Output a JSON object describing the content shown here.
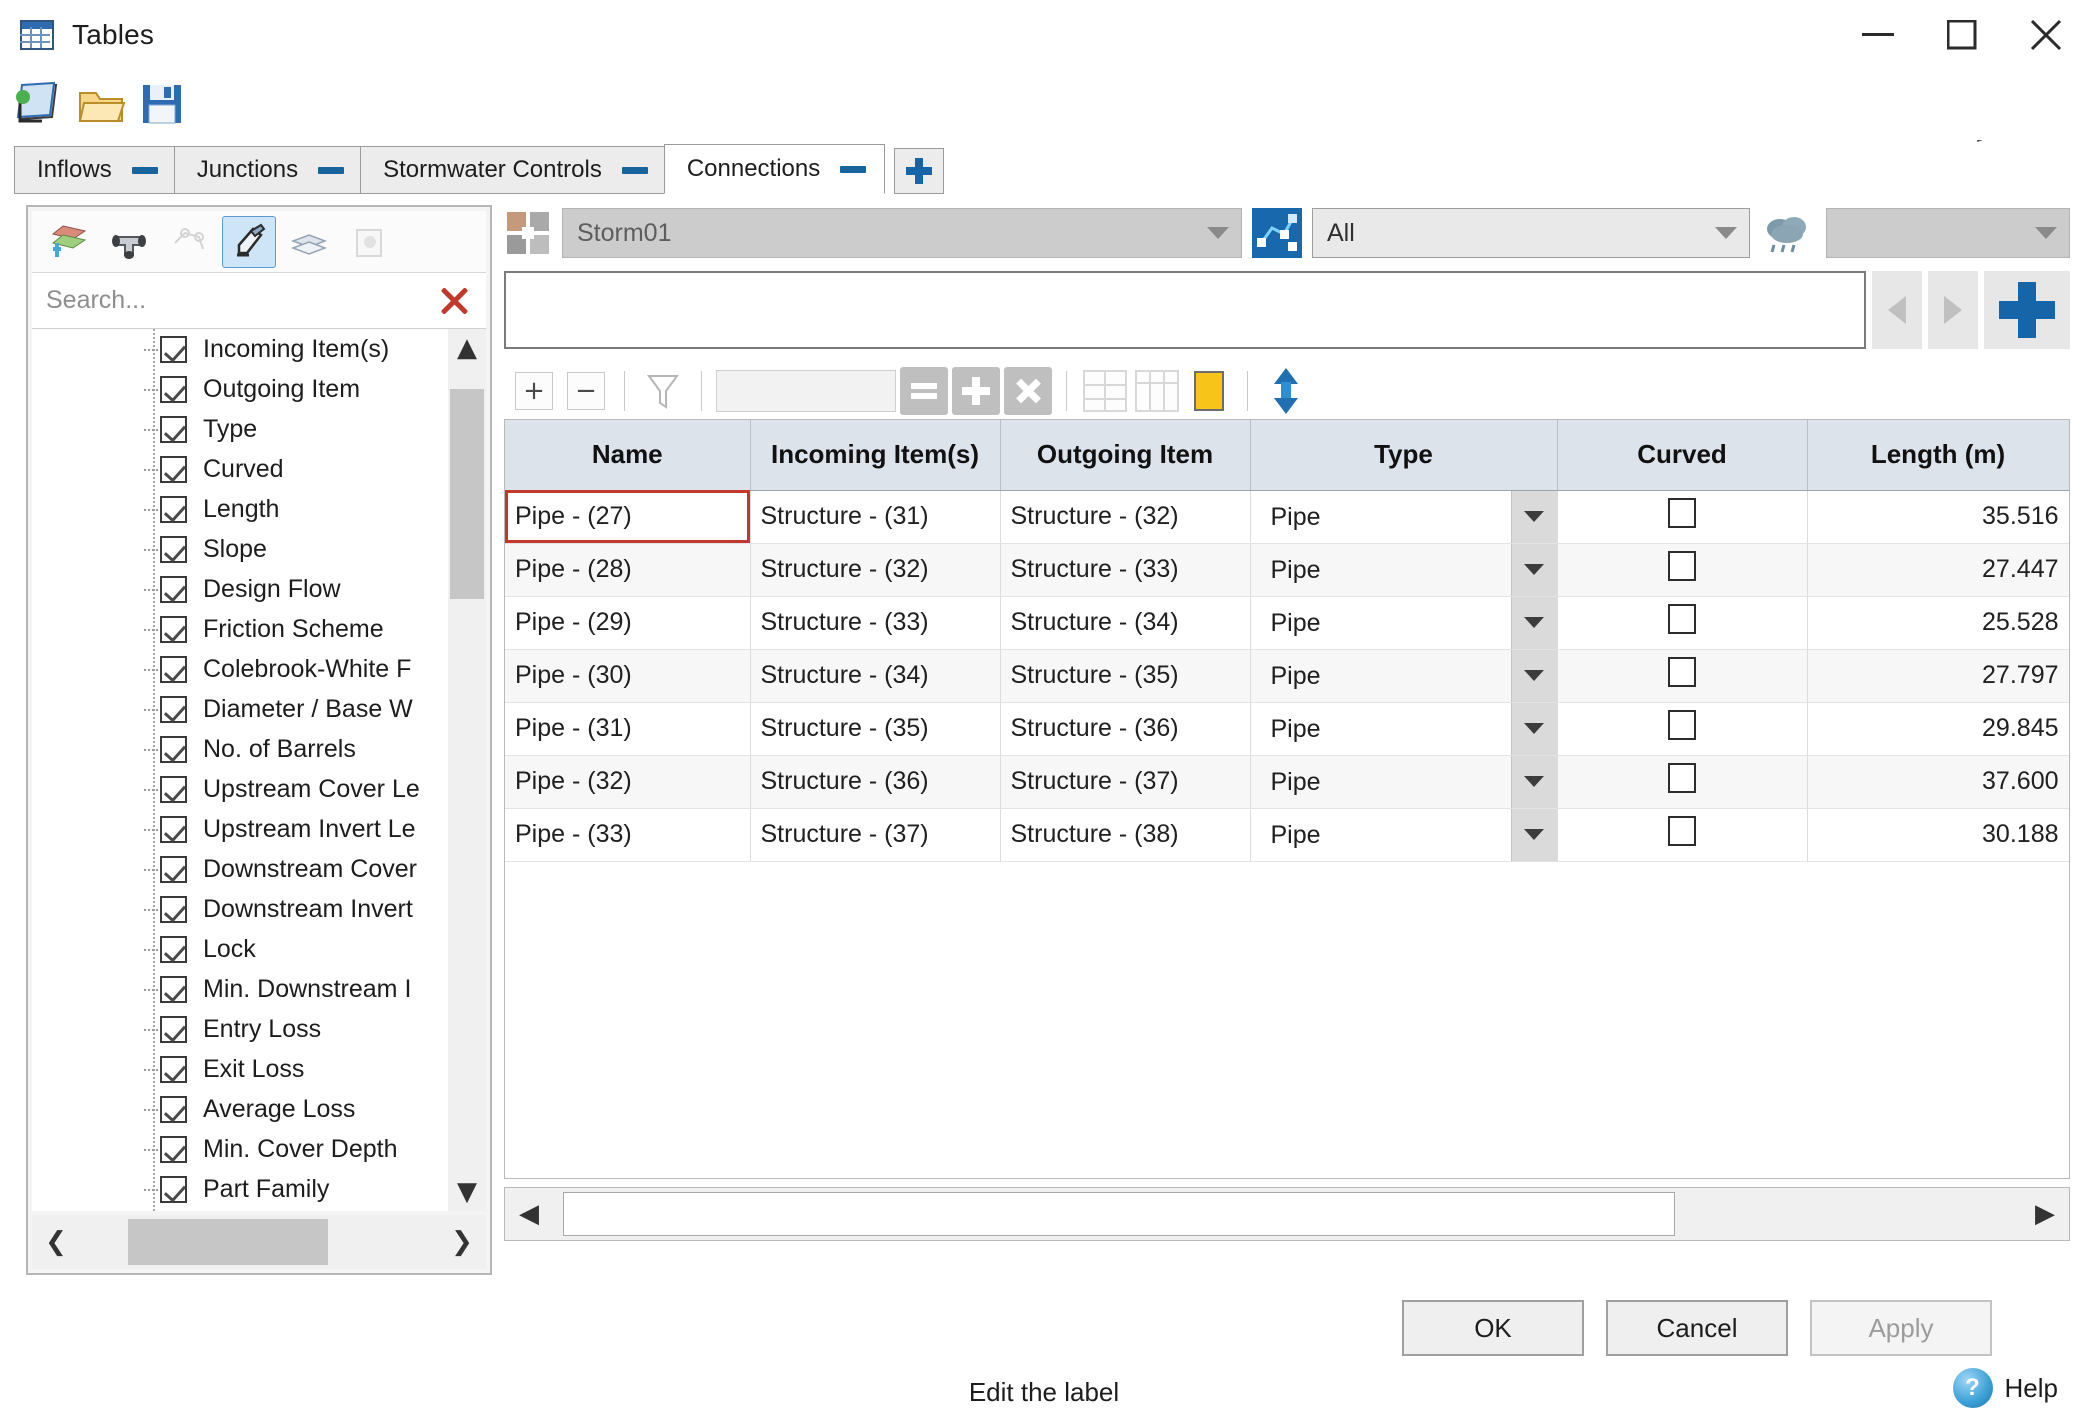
{
  "window": {
    "title": "Tables",
    "icon": "tables-icon",
    "controls": {
      "minimize": "minimize",
      "maximize": "maximize",
      "close": "close"
    }
  },
  "toolbar_top": {
    "buttons": [
      {
        "name": "new-table-icon",
        "label": "New"
      },
      {
        "name": "open-folder-icon",
        "label": "Open"
      },
      {
        "name": "save-disk-icon",
        "label": "Save"
      }
    ]
  },
  "tabs": {
    "items": [
      {
        "label": "Inflows",
        "active": false,
        "close": "—"
      },
      {
        "label": "Junctions",
        "active": false,
        "close": "—"
      },
      {
        "label": "Stormwater Controls",
        "active": false,
        "close": "—"
      },
      {
        "label": "Connections",
        "active": true,
        "close": "—"
      }
    ],
    "add_label": "+"
  },
  "left_panel": {
    "tools": [
      {
        "name": "layers-add-icon",
        "selected": false,
        "enabled": true
      },
      {
        "name": "pipe-junction-icon",
        "selected": false,
        "enabled": true
      },
      {
        "name": "network-outline-icon",
        "selected": false,
        "enabled": false
      },
      {
        "name": "highlight-pen-icon",
        "selected": true,
        "enabled": true
      },
      {
        "name": "stack-layers-icon",
        "selected": false,
        "enabled": true
      },
      {
        "name": "preview-icon",
        "selected": false,
        "enabled": false
      }
    ],
    "search": {
      "placeholder": "Search...",
      "value": "",
      "clear": "clear-search"
    },
    "tree_items": [
      {
        "label": "Incoming Item(s)",
        "checked": true
      },
      {
        "label": "Outgoing Item",
        "checked": true
      },
      {
        "label": "Type",
        "checked": true
      },
      {
        "label": "Curved",
        "checked": true
      },
      {
        "label": "Length",
        "checked": true
      },
      {
        "label": "Slope",
        "checked": true
      },
      {
        "label": "Design Flow",
        "checked": true
      },
      {
        "label": "Friction Scheme",
        "checked": true
      },
      {
        "label": "Colebrook-White F",
        "checked": true
      },
      {
        "label": "Diameter / Base W",
        "checked": true
      },
      {
        "label": "No. of Barrels",
        "checked": true
      },
      {
        "label": "Upstream Cover Le",
        "checked": true
      },
      {
        "label": "Upstream Invert Le",
        "checked": true
      },
      {
        "label": "Downstream Cover",
        "checked": true
      },
      {
        "label": "Downstream Invert",
        "checked": true
      },
      {
        "label": "Lock",
        "checked": true
      },
      {
        "label": "Min. Downstream I",
        "checked": true
      },
      {
        "label": "Entry Loss",
        "checked": true
      },
      {
        "label": "Exit Loss",
        "checked": true
      },
      {
        "label": "Average Loss",
        "checked": true
      },
      {
        "label": "Min. Cover Depth",
        "checked": true
      },
      {
        "label": "Part Family",
        "checked": true
      }
    ]
  },
  "right_panel": {
    "network_combo": {
      "value": "Storm01",
      "icon": "network-parts-icon"
    },
    "filter_combo": {
      "value": "All",
      "icon": "network-graph-icon"
    },
    "rain_combo": {
      "value": "",
      "icon": "rain-cloud-icon"
    },
    "name_field": {
      "value": ""
    },
    "nav": {
      "prev": "previous-record",
      "next": "next-record",
      "add": "add-record"
    },
    "mini_toolbar": [
      {
        "name": "add-row-button",
        "label": "+"
      },
      {
        "name": "remove-row-button",
        "label": "−"
      },
      {
        "name": "filter-funnel-icon",
        "label": ""
      },
      {
        "name": "value-input",
        "label": ""
      },
      {
        "name": "set-equal-button",
        "label": "="
      },
      {
        "name": "increment-button",
        "label": "+"
      },
      {
        "name": "clear-button",
        "label": "×"
      },
      {
        "name": "grid-rows-button",
        "label": ""
      },
      {
        "name": "grid-columns-button",
        "label": ""
      },
      {
        "name": "highlight-color-button",
        "label": ""
      },
      {
        "name": "sort-updown-button",
        "label": ""
      }
    ]
  },
  "table": {
    "columns": [
      "Name",
      "Incoming Item(s)",
      "Outgoing Item",
      "Type",
      "Curved",
      "Length (m)"
    ],
    "selected_cell": {
      "row": 0,
      "column": "Name"
    },
    "rows": [
      {
        "name": "Pipe - (27)",
        "incoming": "Structure - (31)",
        "outgoing": "Structure - (32)",
        "type": "Pipe",
        "curved": false,
        "length": "35.516"
      },
      {
        "name": "Pipe - (28)",
        "incoming": "Structure - (32)",
        "outgoing": "Structure - (33)",
        "type": "Pipe",
        "curved": false,
        "length": "27.447"
      },
      {
        "name": "Pipe - (29)",
        "incoming": "Structure - (33)",
        "outgoing": "Structure - (34)",
        "type": "Pipe",
        "curved": false,
        "length": "25.528"
      },
      {
        "name": "Pipe - (30)",
        "incoming": "Structure - (34)",
        "outgoing": "Structure - (35)",
        "type": "Pipe",
        "curved": false,
        "length": "27.797"
      },
      {
        "name": "Pipe - (31)",
        "incoming": "Structure - (35)",
        "outgoing": "Structure - (36)",
        "type": "Pipe",
        "curved": false,
        "length": "29.845"
      },
      {
        "name": "Pipe - (32)",
        "incoming": "Structure - (36)",
        "outgoing": "Structure - (37)",
        "type": "Pipe",
        "curved": false,
        "length": "37.600"
      },
      {
        "name": "Pipe - (33)",
        "incoming": "Structure - (37)",
        "outgoing": "Structure - (38)",
        "type": "Pipe",
        "curved": false,
        "length": "30.188"
      }
    ]
  },
  "footer": {
    "ok": "OK",
    "cancel": "Cancel",
    "apply": "Apply",
    "apply_disabled": true,
    "status": "Edit the label",
    "help": "Help",
    "help_icon": "?"
  },
  "colors": {
    "accent": "#1565a8",
    "header_bg": "#dde3eb",
    "selection_outline": "#c0392b",
    "tab_active_bg": "#ffffff",
    "tab_inactive_bg": "#ececec"
  }
}
